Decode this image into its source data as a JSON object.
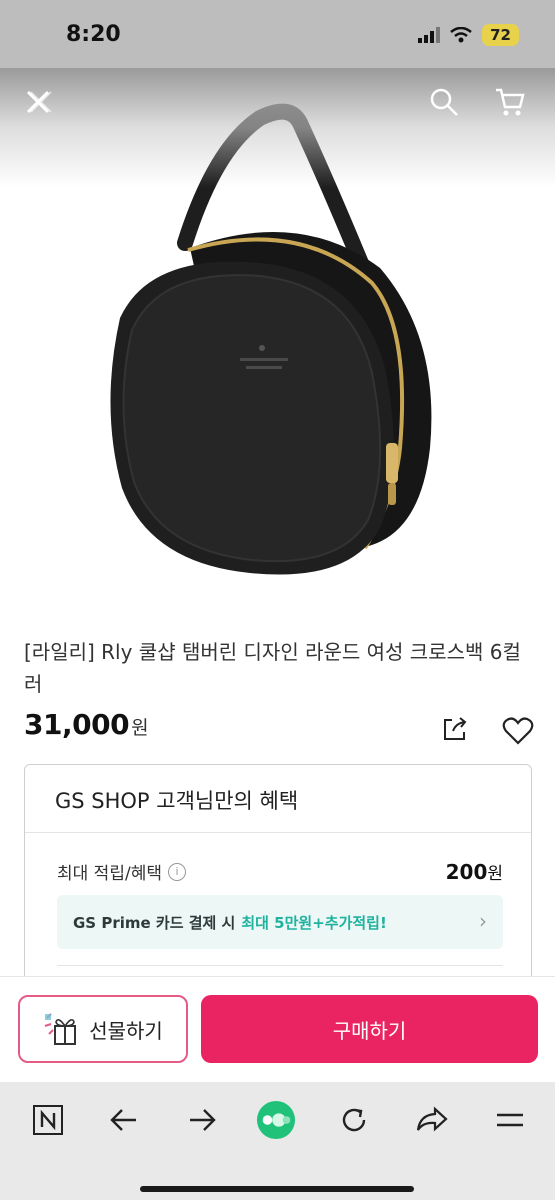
{
  "status": {
    "time": "8:20",
    "battery": "72"
  },
  "product": {
    "title": "[라일리] Rly 쿨샵 탬버린 디자인 라운드 여성 크로스백 6컬러",
    "price": "31,000",
    "currency": "원",
    "image": "black-round-crossbody-bag"
  },
  "benefits": {
    "header": "GS SHOP 고객님만의 혜택",
    "max_label": "최대 적립/혜택",
    "max_value": "200",
    "max_unit": "원",
    "promo_text": "GS Prime 카드 결제 시",
    "promo_accent": "최대 5만원+추가적립!",
    "promo_arrow": "›"
  },
  "actions": {
    "gift_label": "선물하기",
    "buy_label": "구매하기"
  },
  "colors": {
    "accent": "#ea2462",
    "gift_border": "#e45b86",
    "promo_accent": "#1fb39f"
  },
  "icons": [
    "close-icon",
    "search-icon",
    "cart-icon",
    "share-icon",
    "heart-icon",
    "info-icon",
    "gift-icon",
    "naver-icon",
    "back-icon",
    "forward-icon",
    "green-dot-icon",
    "refresh-icon",
    "share-arrow-icon",
    "menu-icon"
  ]
}
